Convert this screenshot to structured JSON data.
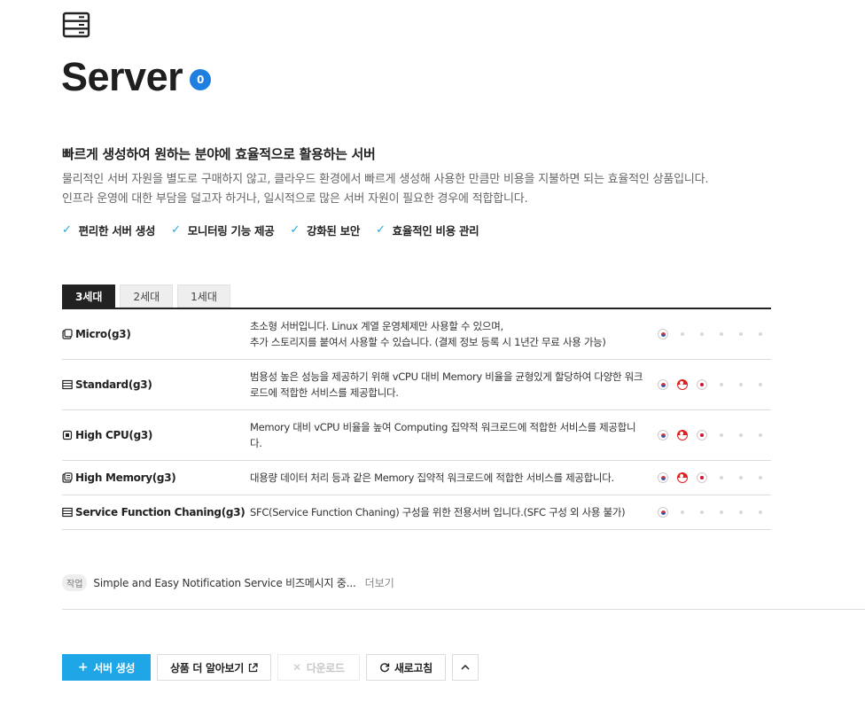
{
  "header": {
    "icon": "server-rack-icon",
    "title": "Server",
    "count": "0"
  },
  "intro": {
    "headline": "빠르게 생성하여 원하는 분야에 효율적으로 활용하는 서버",
    "desc_line1": "물리적인 서버 자원을 별도로 구매하지 않고, 클라우드 환경에서 빠르게 생성해 사용한 만큼만 비용을 지불하면 되는 효율적인 상품입니다.",
    "desc_line2": "인프라 운영에 대한 부담을 덜고자 하거나, 일시적으로 많은 서버 자원이 필요한 경우에 적합합니다."
  },
  "features": [
    "편리한 서버 생성",
    "모니터링 기능 제공",
    "강화된 보안",
    "효율적인 비용 관리"
  ],
  "tabs": [
    {
      "label": "3세대",
      "active": true
    },
    {
      "label": "2세대",
      "active": false
    },
    {
      "label": "1세대",
      "active": false
    }
  ],
  "servers": [
    {
      "name": "Micro(g3)",
      "icon": "micro-server-icon",
      "desc1": "초소형 서버입니다. Linux 계열 운영체제만 사용할 수 있으며,",
      "desc2": "추가 스토리지를 붙여서 사용할 수 있습니다. (결제 정보 등록 시 1년간 무료 사용 가능)",
      "regions": [
        "kr",
        "-",
        "-",
        "-",
        "-",
        "-"
      ]
    },
    {
      "name": "Standard(g3)",
      "icon": "standard-server-icon",
      "desc1": "범용성 높은 성능을 제공하기 위해 vCPU 대비 Memory 비율을 균형있게 할당하여 다양한 워크",
      "desc2": "로드에 적합한 서비스를 제공합니다.",
      "regions": [
        "kr",
        "sg",
        "jp",
        "-",
        "-",
        "-"
      ]
    },
    {
      "name": "High CPU(g3)",
      "icon": "cpu-server-icon",
      "desc1": "Memory 대비 vCPU 비율을 높여 Computing 집약적 워크로드에 적합한 서비스를 제공합니",
      "desc2": "다.",
      "regions": [
        "kr",
        "sg",
        "jp",
        "-",
        "-",
        "-"
      ]
    },
    {
      "name": "High Memory(g3)",
      "icon": "memory-server-icon",
      "desc1": "대용량 데이터 처리 등과 같은 Memory 집약적 워크로드에 적합한 서비스를 제공합니다.",
      "desc2": "",
      "regions": [
        "kr",
        "sg",
        "jp",
        "-",
        "-",
        "-"
      ]
    },
    {
      "name": "Service Function Chaning(g3)",
      "icon": "sfc-server-icon",
      "desc1": "SFC(Service Function Chaning) 구성을 위한 전용서버 입니다.(SFC 구성 외 사용 불가)",
      "desc2": "",
      "regions": [
        "kr",
        "-",
        "-",
        "-",
        "-",
        "-"
      ]
    }
  ],
  "task": {
    "badge": "작업",
    "text": "Simple and Easy Notification Service 비즈메시지 중...",
    "more": "더보기"
  },
  "actions": {
    "create": "서버 생성",
    "learn_more": "상품 더 알아보기",
    "download": "다운로드",
    "refresh": "새로고침"
  }
}
